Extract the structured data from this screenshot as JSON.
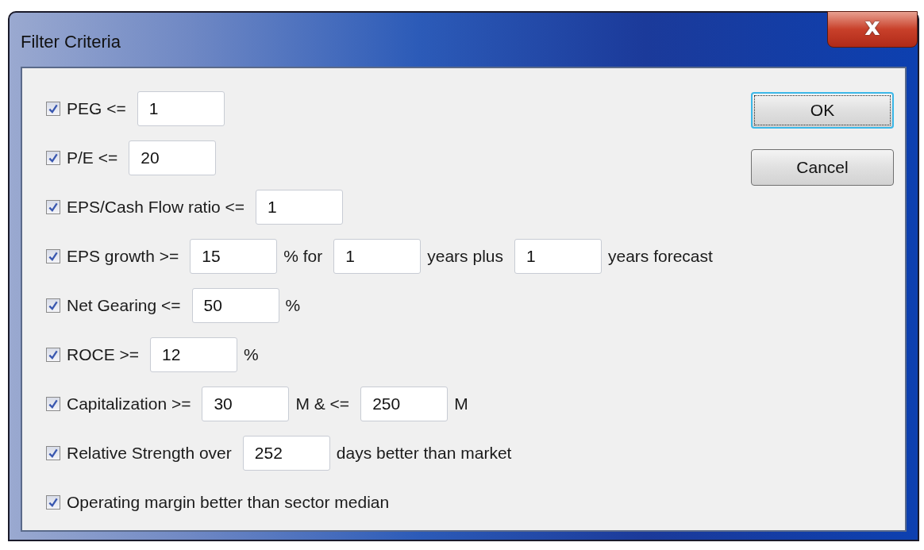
{
  "window": {
    "title": "Filter Criteria",
    "close": "x"
  },
  "criteria": [
    {
      "checked": true,
      "parts": [
        {
          "kind": "label",
          "text": "PEG <="
        },
        {
          "kind": "field",
          "value": "1"
        }
      ]
    },
    {
      "checked": true,
      "parts": [
        {
          "kind": "label",
          "text": "P/E <="
        },
        {
          "kind": "field",
          "value": "20"
        }
      ]
    },
    {
      "checked": true,
      "parts": [
        {
          "kind": "label",
          "text": "EPS/Cash Flow ratio <="
        },
        {
          "kind": "field",
          "value": "1"
        }
      ]
    },
    {
      "checked": true,
      "parts": [
        {
          "kind": "label",
          "text": "EPS growth >="
        },
        {
          "kind": "field",
          "value": "15"
        },
        {
          "kind": "label",
          "text": "% for"
        },
        {
          "kind": "field",
          "value": "1"
        },
        {
          "kind": "label",
          "text": "years plus"
        },
        {
          "kind": "field",
          "value": "1"
        },
        {
          "kind": "label",
          "text": "years forecast"
        }
      ]
    },
    {
      "checked": true,
      "parts": [
        {
          "kind": "label",
          "text": "Net Gearing <="
        },
        {
          "kind": "field",
          "value": "50"
        },
        {
          "kind": "label",
          "text": "%"
        }
      ]
    },
    {
      "checked": true,
      "parts": [
        {
          "kind": "label",
          "text": "ROCE >="
        },
        {
          "kind": "field",
          "value": "12"
        },
        {
          "kind": "label",
          "text": "%"
        }
      ]
    },
    {
      "checked": true,
      "parts": [
        {
          "kind": "label",
          "text": "Capitalization >="
        },
        {
          "kind": "field",
          "value": "30"
        },
        {
          "kind": "label",
          "text": "M & <="
        },
        {
          "kind": "field",
          "value": "250"
        },
        {
          "kind": "label",
          "text": "M"
        }
      ]
    },
    {
      "checked": true,
      "parts": [
        {
          "kind": "label",
          "text": "Relative Strength over"
        },
        {
          "kind": "field",
          "value": "252"
        },
        {
          "kind": "label",
          "text": "days better than market"
        }
      ]
    },
    {
      "checked": true,
      "parts": [
        {
          "kind": "label",
          "text": "Operating margin better than sector median"
        }
      ]
    }
  ],
  "buttons": [
    {
      "label": "OK",
      "default": true
    },
    {
      "label": "Cancel",
      "default": false
    }
  ]
}
